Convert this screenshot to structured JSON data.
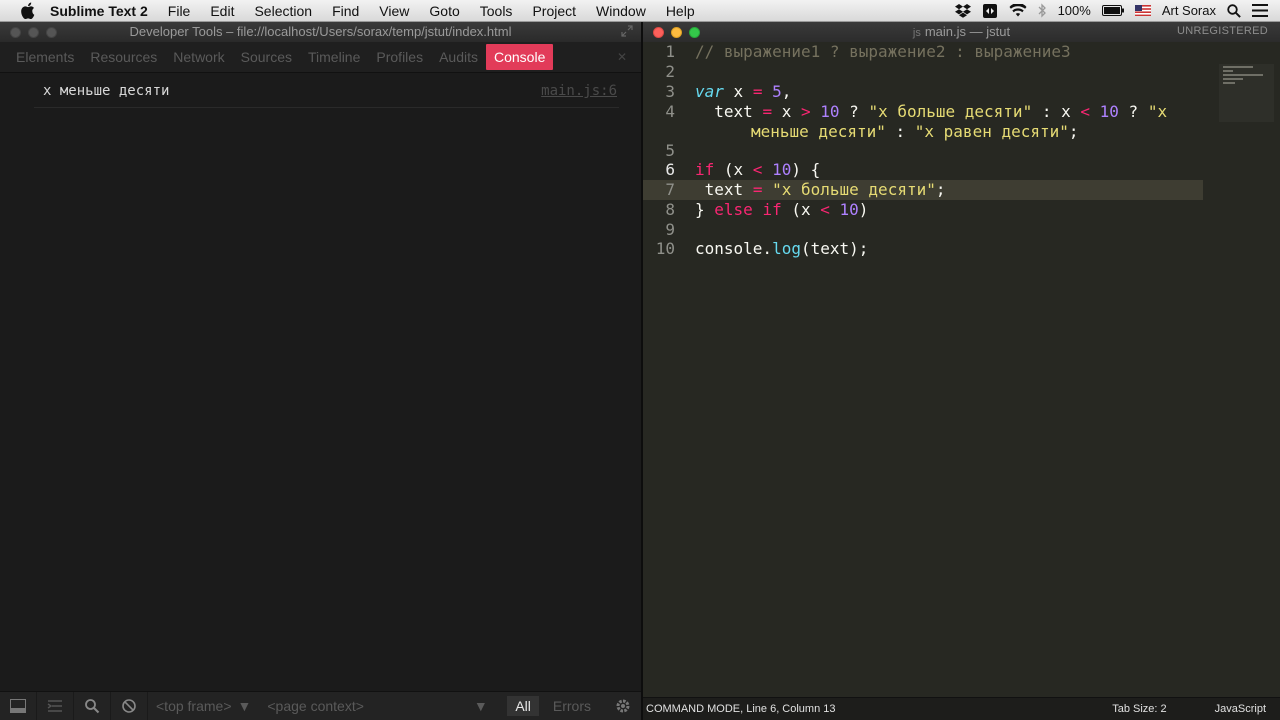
{
  "menubar": {
    "app_name": "Sublime Text 2",
    "items": [
      "File",
      "Edit",
      "Selection",
      "Find",
      "View",
      "Goto",
      "Tools",
      "Project",
      "Window",
      "Help"
    ],
    "battery": "100%",
    "user": "Art Sorax"
  },
  "devtools": {
    "window_title": "Developer Tools – file://localhost/Users/sorax/temp/jstut/index.html",
    "tabs": [
      "Elements",
      "Resources",
      "Network",
      "Sources",
      "Timeline",
      "Profiles",
      "Audits",
      "Console"
    ],
    "active_tab": "Console",
    "console": {
      "message": "x меньше десяти",
      "source": "main.js:6"
    },
    "bottom": {
      "frame_select": "<top frame>",
      "context_select": "<page context>",
      "filter_all": "All",
      "filter_errors": "Errors"
    }
  },
  "editor": {
    "window_title": "main.js — jstut",
    "file_badge": "js",
    "unregistered": "UNREGISTERED",
    "line_numbers": [
      "1",
      "2",
      "3",
      "4",
      "",
      "5",
      "6",
      "7",
      "8",
      "9",
      "10"
    ],
    "active_line": "6",
    "code": {
      "l1": "// выражение1 ? выражение2 : выражение3",
      "l3_var": "var",
      "l3_x": " x ",
      "l3_eq": "=",
      "l3_num": "5",
      "l3_comma": ",",
      "l4_text": "text ",
      "l4_eq": "=",
      "l4_x": " x ",
      "l4_gt": ">",
      "l4_n1": "10",
      "l4_q1": " ? ",
      "l4_s1": "\"x больше десяти\"",
      "l4_colon": " : x ",
      "l4_lt": "<",
      "l4_n2": "10",
      "l4_q2": " ? ",
      "l4_s2a": "\"x",
      "l4b_s2b": "меньше десяти\"",
      "l4b_colon": " : ",
      "l4b_s3": "\"x равен десяти\"",
      "l4b_semi": ";",
      "l6_if": "if",
      "l6_open": " (x ",
      "l6_lt": "<",
      "l6_num": "10",
      "l6_close": ") {",
      "l7_text": "text ",
      "l7_eq": "=",
      "l7_str": "\"x больше десяти\"",
      "l7_semi": ";",
      "l8_brace": "} ",
      "l8_else": "else",
      "l8_if": "if",
      "l8_open": " (x ",
      "l8_lt": "<",
      "l8_num": "10",
      "l8_close": ")",
      "l10_console": "console.",
      "l10_log": "log",
      "l10_rest": "(text);"
    }
  },
  "statusbar": {
    "mode": "COMMAND MODE, Line 6, Column 13",
    "tab_size": "Tab Size: 2",
    "syntax": "JavaScript"
  },
  "colors": {
    "console_tab": "#e23b59",
    "editor_bg": "#272822",
    "keyword": "#f92672",
    "number": "#ae81ff",
    "string": "#e6db74",
    "comment": "#75715e"
  },
  "icons": [
    "apple-icon",
    "dropbox-icon",
    "tool-icon",
    "wifi-icon",
    "bluetooth-icon",
    "battery-icon",
    "flag-icon",
    "spotlight-icon",
    "list-icon",
    "dock-icon",
    "console-drawer-icon",
    "search-icon",
    "clear-icon",
    "gear-icon"
  ]
}
